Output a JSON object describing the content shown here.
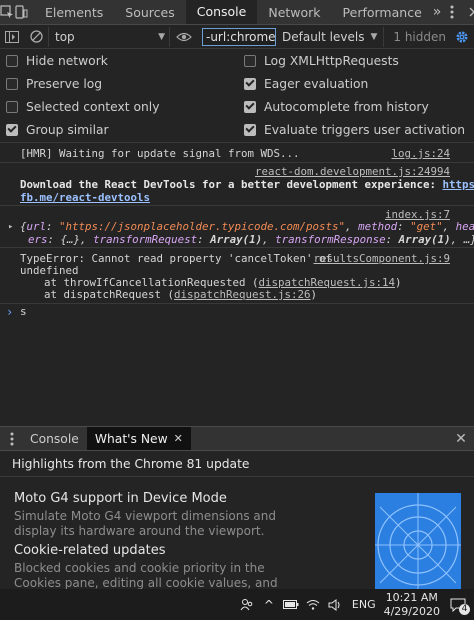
{
  "tabbar": {
    "tabs": [
      {
        "label": "Elements"
      },
      {
        "label": "Sources"
      },
      {
        "label": "Console"
      },
      {
        "label": "Network"
      },
      {
        "label": "Performance"
      }
    ],
    "more": "»"
  },
  "toolbar": {
    "context": "top",
    "filter_value": "-url:chrome",
    "levels": "Default levels",
    "hidden": "1 hidden"
  },
  "settings": [
    {
      "label": "Hide network",
      "checked": false
    },
    {
      "label": "Log XMLHttpRequests",
      "checked": false
    },
    {
      "label": "Preserve log",
      "checked": false
    },
    {
      "label": "Eager evaluation",
      "checked": true
    },
    {
      "label": "Selected context only",
      "checked": false
    },
    {
      "label": "Autocomplete from history",
      "checked": true
    },
    {
      "label": "Group similar",
      "checked": true
    },
    {
      "label": "Evaluate triggers user activation",
      "checked": true
    }
  ],
  "console": {
    "hmr_text": "[HMR] Waiting for update signal from WDS...",
    "hmr_src": "log.js:24",
    "react_src": "react-dom.development.js:24994",
    "react_text1": "Download the React DevTools for a better development experience: ",
    "react_link1": "https://",
    "react_link2": "fb.me/react-devtools",
    "obj_src": "index.js:7",
    "obj": {
      "brace": "{",
      "url_key": "url",
      "url_val": "\"https://jsonplaceholder.typicode.com/posts\"",
      "method_key": "method",
      "method_val": "\"get\"",
      "head_key1": "head",
      "head_key2": "ers",
      "headers_val": "{…}",
      "tr_key": "transformRequest",
      "tr_val": "Array(1)",
      "tresp_key": "transformResponse",
      "tresp_val": "Array(1)",
      "ellipsis": "…}"
    },
    "err_line1": "TypeError: Cannot read property 'cancelToken' of",
    "err_line2": "undefined",
    "err_src": "resultsComponent.js:9",
    "stack1_prefix": "at throwIfCancellationRequested (",
    "stack1_link": "dispatchRequest.js:14",
    "stack2_prefix": "at dispatchRequest (",
    "stack2_link": "dispatchRequest.js:26",
    "close_paren": ")",
    "input_value": "s"
  },
  "drawer": {
    "tabs": [
      {
        "label": "Console"
      },
      {
        "label": "What's New"
      }
    ],
    "header": "Highlights from the Chrome 81 update",
    "items": [
      {
        "title": "Moto G4 support in Device Mode",
        "text": "Simulate Moto G4 viewport dimensions and display its hardware around the viewport."
      },
      {
        "title": "Cookie-related updates",
        "text": "Blocked cookies and cookie priority in the Cookies pane, editing all cookie values, and more."
      }
    ]
  },
  "taskbar": {
    "lang": "ENG",
    "time": "10:21 AM",
    "date": "4/29/2020",
    "notification_count": "4"
  },
  "colors": {
    "accent": "#6c9fd6",
    "link": "#9bc1ff",
    "string": "#f28b54",
    "property": "#d8a6f5",
    "prompt": "#6aa6ff"
  }
}
